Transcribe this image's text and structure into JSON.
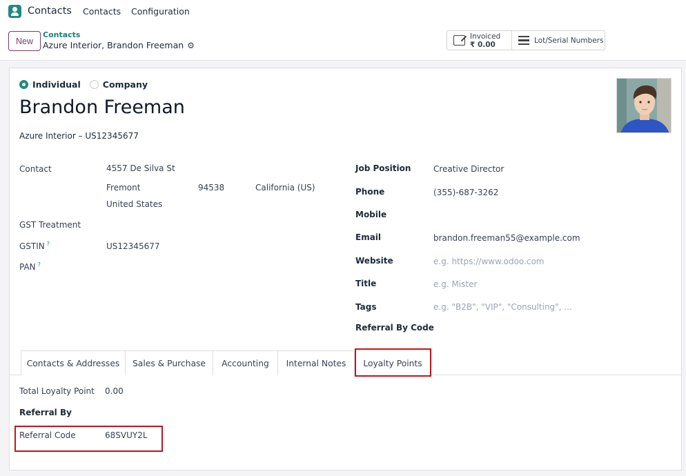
{
  "navbar": {
    "app_name": "Contacts",
    "menu": [
      "Contacts",
      "Configuration"
    ]
  },
  "control_panel": {
    "new_label": "New",
    "breadcrumb_parent": "Contacts",
    "breadcrumb_current": "Azure Interior, Brandon Freeman",
    "smart_buttons": {
      "invoiced_label": "Invoiced",
      "invoiced_value": "₹ 0.00",
      "lot_label": "Lot/Serial Numbers"
    }
  },
  "form": {
    "radio_individual": "Individual",
    "radio_company": "Company",
    "selected_type": "Individual",
    "name": "Brandon Freeman",
    "company_vat": "Azure Interior – US12345677",
    "left": {
      "contact_label": "Contact",
      "street": "4557 De Silva St",
      "city": "Fremont",
      "zip": "94538",
      "state": "California (US)",
      "country": "United States",
      "gst_treatment_label": "GST Treatment",
      "gstin_label": "GSTIN",
      "gstin_help": "?",
      "gstin_value": "US12345677",
      "pan_label": "PAN",
      "pan_help": "?"
    },
    "right": {
      "job_position_label": "Job Position",
      "job_position_value": "Creative Director",
      "phone_label": "Phone",
      "phone_value": "(355)-687-3262",
      "mobile_label": "Mobile",
      "email_label": "Email",
      "email_value": "brandon.freeman55@example.com",
      "website_label": "Website",
      "website_placeholder": "e.g. https://www.odoo.com",
      "title_label": "Title",
      "title_placeholder": "e.g. Mister",
      "tags_label": "Tags",
      "tags_placeholder": "e.g. \"B2B\", \"VIP\", \"Consulting\", ...",
      "referral_by_code_label": "Referral By Code"
    },
    "tabs": [
      "Contacts & Addresses",
      "Sales & Purchase",
      "Accounting",
      "Internal Notes",
      "Loyalty Points"
    ],
    "active_tab": "Loyalty Points",
    "loyalty": {
      "total_label": "Total Loyalty Point",
      "total_value": "0.00",
      "referral_by_label": "Referral By",
      "referral_code_label": "Referral Code",
      "referral_code_value": "68SVUY2L"
    }
  },
  "colors": {
    "brand_teal": "#1f8a82",
    "primary_purple": "#7a3b64",
    "highlight_red": "#c0141e"
  }
}
